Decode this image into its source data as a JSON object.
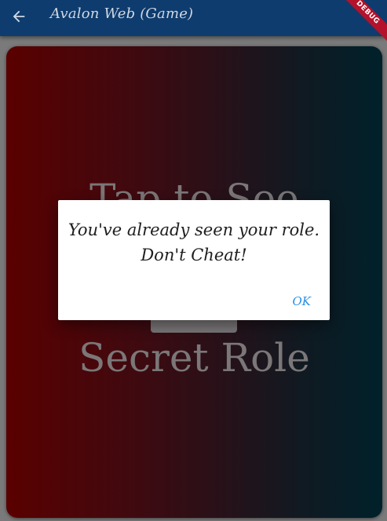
{
  "appbar": {
    "title": "Avalon Web (Game)",
    "back_icon": "arrow-back-icon",
    "debug_label": "DEBUG"
  },
  "card": {
    "line1": "Tap to See",
    "line2": "Secret Role"
  },
  "dialog": {
    "message_line1": "You've already seen your role.",
    "message_line2": "Don't Cheat!",
    "ok_label": "OK"
  },
  "colors": {
    "appbar": "#0e3c6e",
    "card_left": "#5a0000",
    "card_right": "#00212b",
    "ok_accent": "#2a8fe6"
  }
}
